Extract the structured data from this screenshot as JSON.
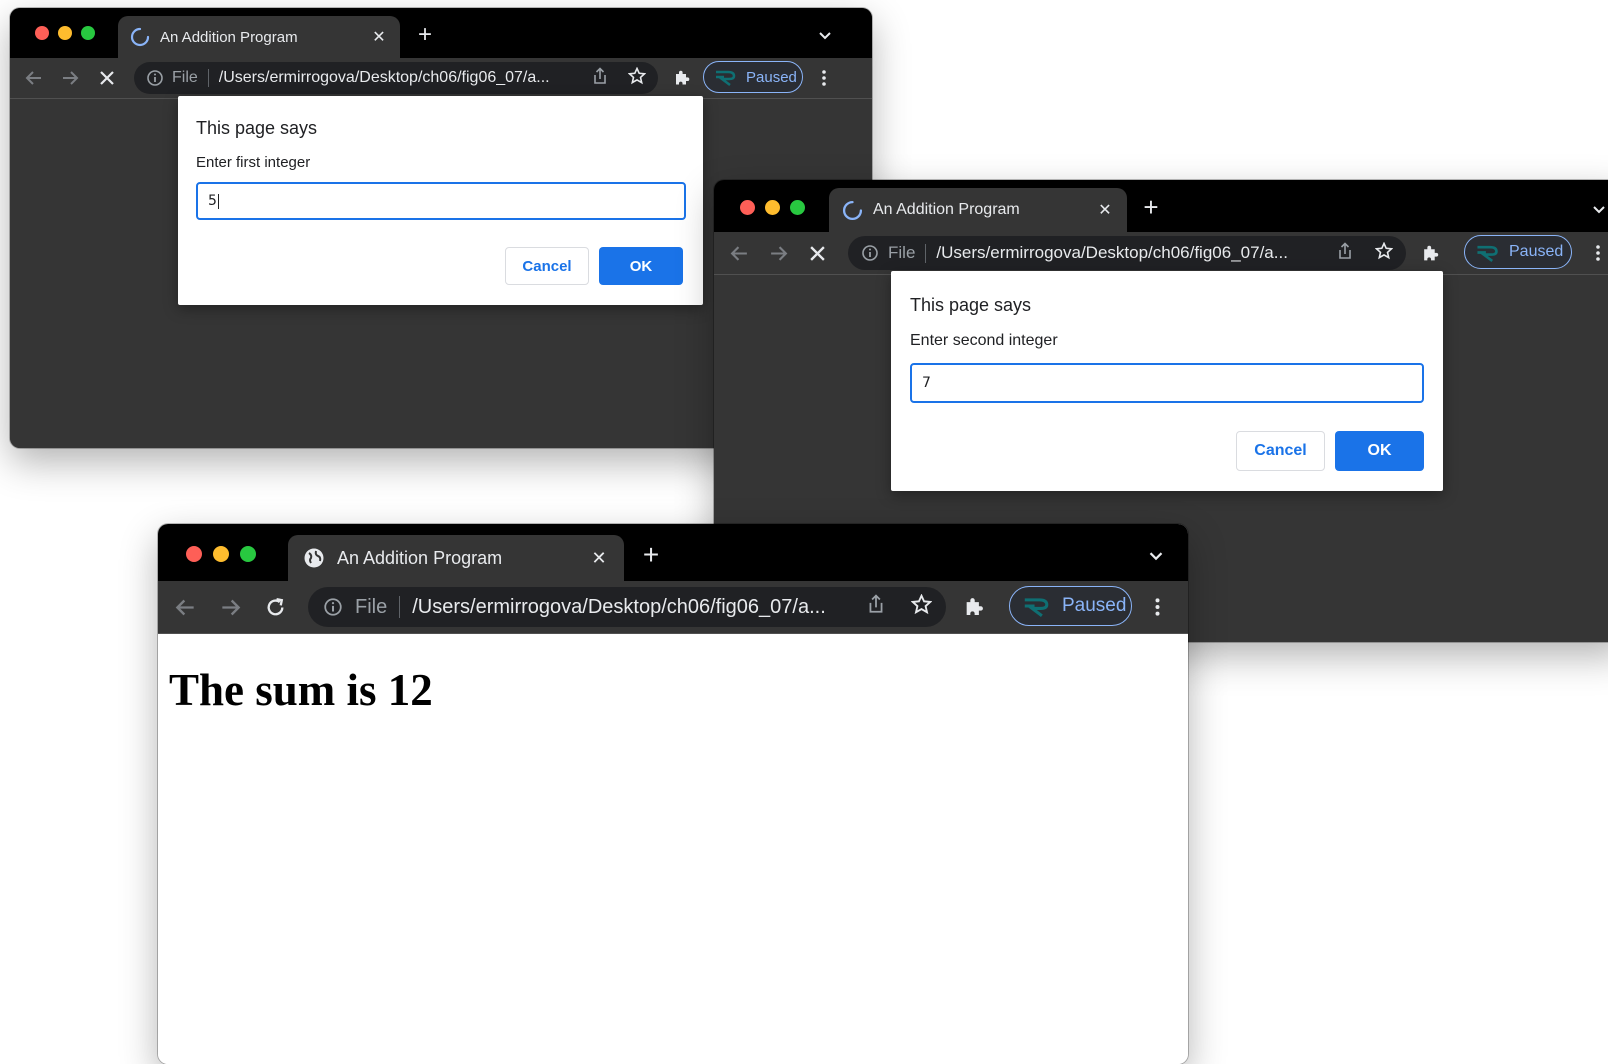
{
  "windows": [
    {
      "tab_title": "An Addition Program",
      "tab_icon": "loading-spinner-icon",
      "reload_state": "stop-icon",
      "address": {
        "scheme_label": "File",
        "url": "/Users/ermirrogova/Desktop/ch06/fig06_07/a..."
      },
      "profile": {
        "label": "Paused"
      },
      "dialog": {
        "title": "This page says",
        "message": "Enter first integer",
        "input_value": "5",
        "cancel_label": "Cancel",
        "ok_label": "OK"
      }
    },
    {
      "tab_title": "An Addition Program",
      "tab_icon": "loading-spinner-icon",
      "reload_state": "stop-icon",
      "address": {
        "scheme_label": "File",
        "url": "/Users/ermirrogova/Desktop/ch06/fig06_07/a..."
      },
      "profile": {
        "label": "Paused"
      },
      "dialog": {
        "title": "This page says",
        "message": "Enter second integer",
        "input_value": "7",
        "cancel_label": "Cancel",
        "ok_label": "OK"
      }
    },
    {
      "tab_title": "An Addition Program",
      "tab_icon": "globe-icon",
      "reload_state": "reload-icon",
      "address": {
        "scheme_label": "File",
        "url": "/Users/ermirrogova/Desktop/ch06/fig06_07/a..."
      },
      "profile": {
        "label": "Paused"
      },
      "page": {
        "heading": "The sum is 12"
      }
    }
  ],
  "colors": {
    "dialog_accent": "#1a73e8",
    "paused_accent": "#8ab4f8",
    "dark_chrome": "#353535"
  }
}
